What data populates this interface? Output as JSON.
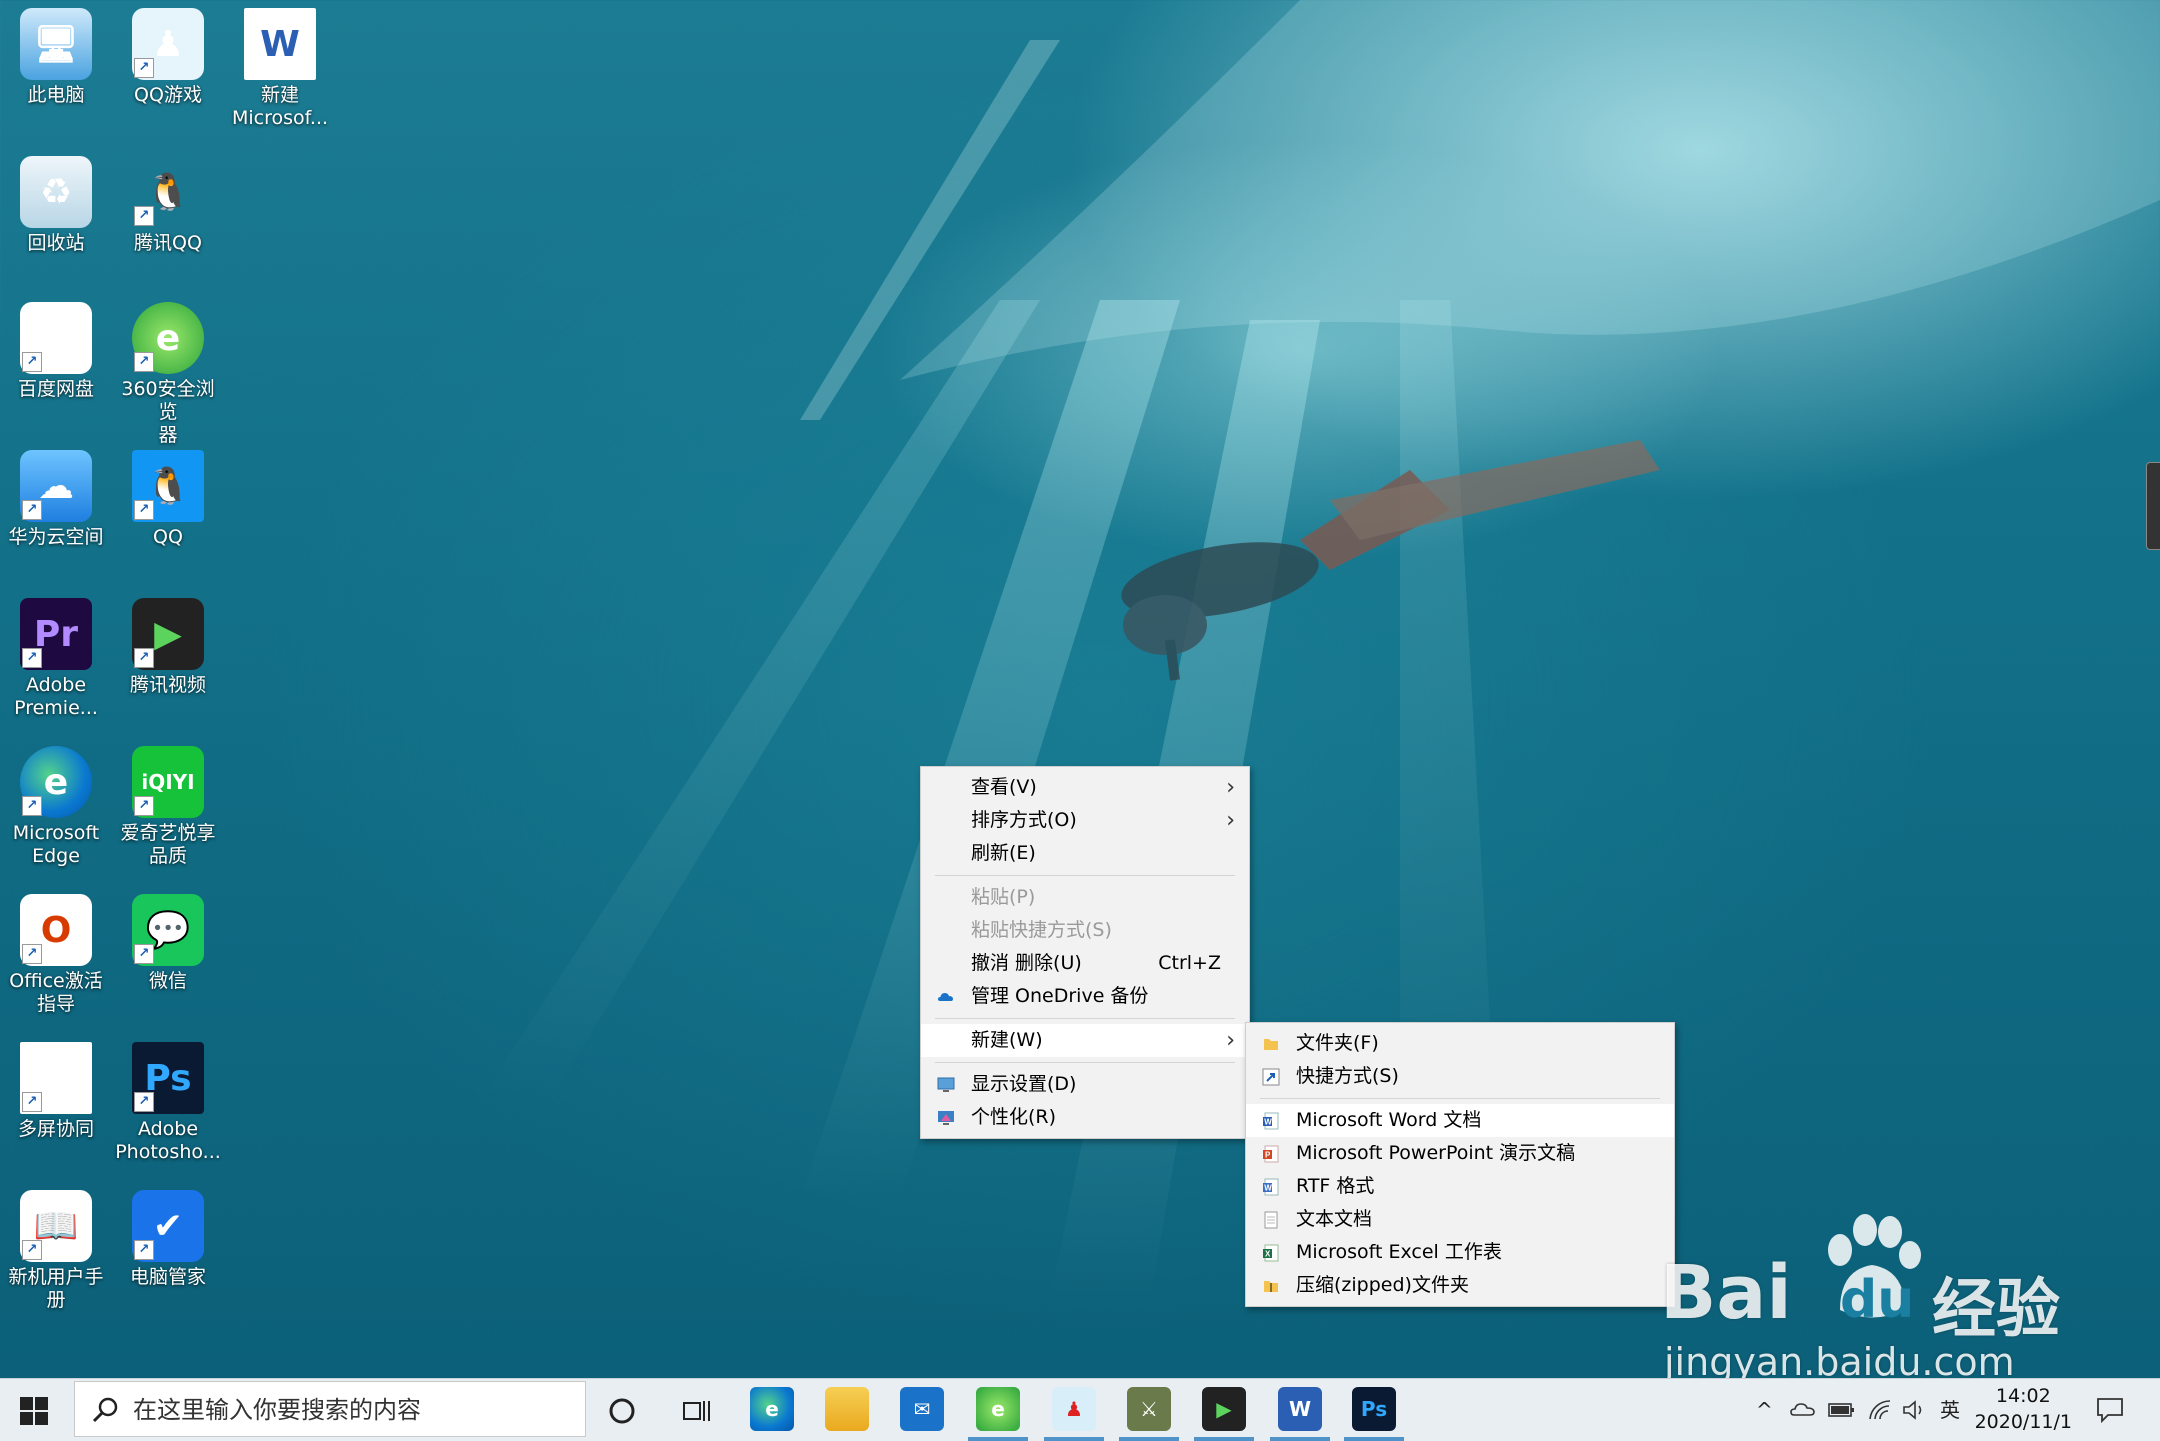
{
  "desktop": {
    "icons": [
      {
        "label": "此电脑",
        "icon": "computer-icon"
      },
      {
        "label": "QQ游戏",
        "icon": "qq-game-icon"
      },
      {
        "label": "新建\nMicrosof...",
        "icon": "word-doc-icon"
      },
      {
        "label": "回收站",
        "icon": "recycle-bin-icon"
      },
      {
        "label": "腾讯QQ",
        "icon": "qq-penguin-icon"
      },
      {
        "label": "百度网盘",
        "icon": "baidu-netdisk-icon"
      },
      {
        "label": "360安全浏览\n器",
        "icon": "browser-360-icon"
      },
      {
        "label": "华为云空间",
        "icon": "huawei-cloud-icon"
      },
      {
        "label": "QQ",
        "icon": "qq-icon"
      },
      {
        "label": "Adobe\nPremie...",
        "icon": "premiere-icon",
        "glyph": "Pr"
      },
      {
        "label": "腾讯视频",
        "icon": "tencent-video-icon"
      },
      {
        "label": "Microsoft\nEdge",
        "icon": "edge-icon"
      },
      {
        "label": "爱奇艺悦享\n品质",
        "icon": "iqiyi-icon",
        "glyph": "iQIYI"
      },
      {
        "label": "Office激活\n指导",
        "icon": "office-icon"
      },
      {
        "label": "微信",
        "icon": "wechat-icon"
      },
      {
        "label": "多屏协同",
        "icon": "multiscreen-icon"
      },
      {
        "label": "Adobe\nPhotosho...",
        "icon": "photoshop-icon",
        "glyph": "Ps"
      },
      {
        "label": "新机用户手册",
        "icon": "user-manual-icon"
      },
      {
        "label": "电脑管家",
        "icon": "pc-manager-icon"
      }
    ]
  },
  "context_menu": {
    "view": "查看(V)",
    "sort": "排序方式(O)",
    "refresh": "刷新(E)",
    "paste": "粘贴(P)",
    "paste_shortcut": "粘贴快捷方式(S)",
    "undo": "撤消 删除(U)",
    "undo_shortcut": "Ctrl+Z",
    "onedrive": "管理 OneDrive 备份",
    "new": "新建(W)",
    "display": "显示设置(D)",
    "personalize": "个性化(R)"
  },
  "submenu": {
    "folder": "文件夹(F)",
    "shortcut": "快捷方式(S)",
    "word": "Microsoft Word 文档",
    "ppt": "Microsoft PowerPoint 演示文稿",
    "rtf": "RTF 格式",
    "text": "文本文档",
    "excel": "Microsoft Excel 工作表",
    "zip": "压缩(zipped)文件夹"
  },
  "taskbar": {
    "search_placeholder": "在这里输入你要搜索的内容",
    "ime": "英",
    "time": "14:02",
    "date": "2020/11/1"
  },
  "watermark": {
    "brand": "Bai",
    "brand2": "du",
    "cn": "经验",
    "url": "jingyan.baidu.com"
  },
  "colors": {
    "accent": "#4f93c8",
    "menu_bg": "#f2f2f2",
    "taskbar_bg": "#e8eef2"
  }
}
